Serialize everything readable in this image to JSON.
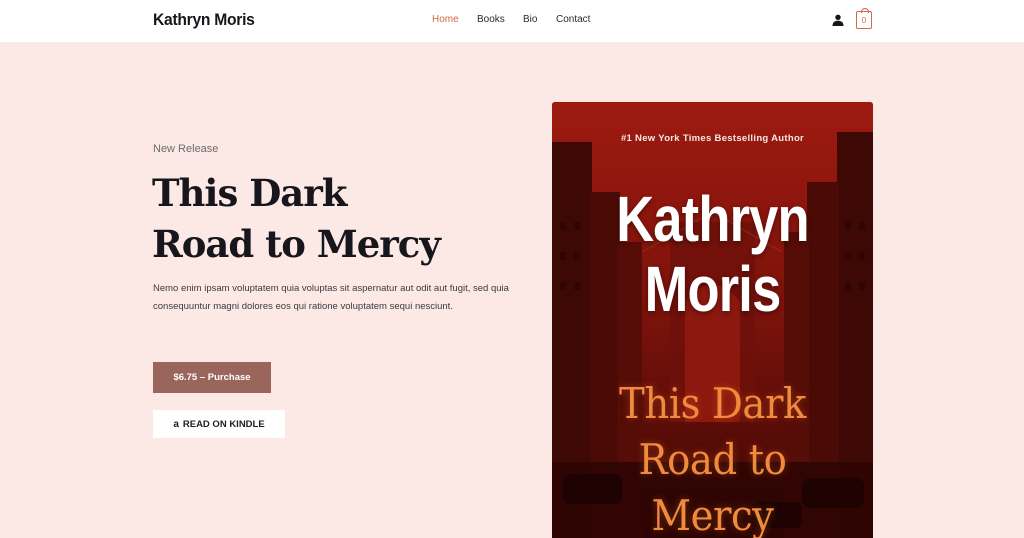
{
  "header": {
    "logo": "Kathryn Moris",
    "nav": [
      {
        "label": "Home",
        "active": true
      },
      {
        "label": "Books",
        "active": false
      },
      {
        "label": "Bio",
        "active": false
      },
      {
        "label": "Contact",
        "active": false
      }
    ],
    "cart_count": "0",
    "accent_color": "#d2694a"
  },
  "hero": {
    "eyebrow": "New Release",
    "title_lines": [
      "This Dark",
      "Road to Mercy"
    ],
    "description": "Nemo enim ipsam voluptatem quia voluptas sit aspernatur aut odit aut fugit, sed quia consequuntur magni dolores eos qui ratione voluptatem sequi nesciunt.",
    "purchase_label": "$6.75 – Purchase",
    "kindle_label": "READ ON KINDLE",
    "kindle_icon": "amazon-icon",
    "kindle_icon_glyph": "a",
    "purchase_color": "#9a665c",
    "background_color": "#fce9e5"
  },
  "cover": {
    "tagline": "#1 New York Times Bestselling Author",
    "author_lines": [
      "Kathryn",
      "Moris"
    ],
    "title_lines": [
      "This Dark",
      "Road to",
      "Mercy"
    ],
    "background_color": "#5a0d08",
    "title_color": "#f08a3c"
  }
}
